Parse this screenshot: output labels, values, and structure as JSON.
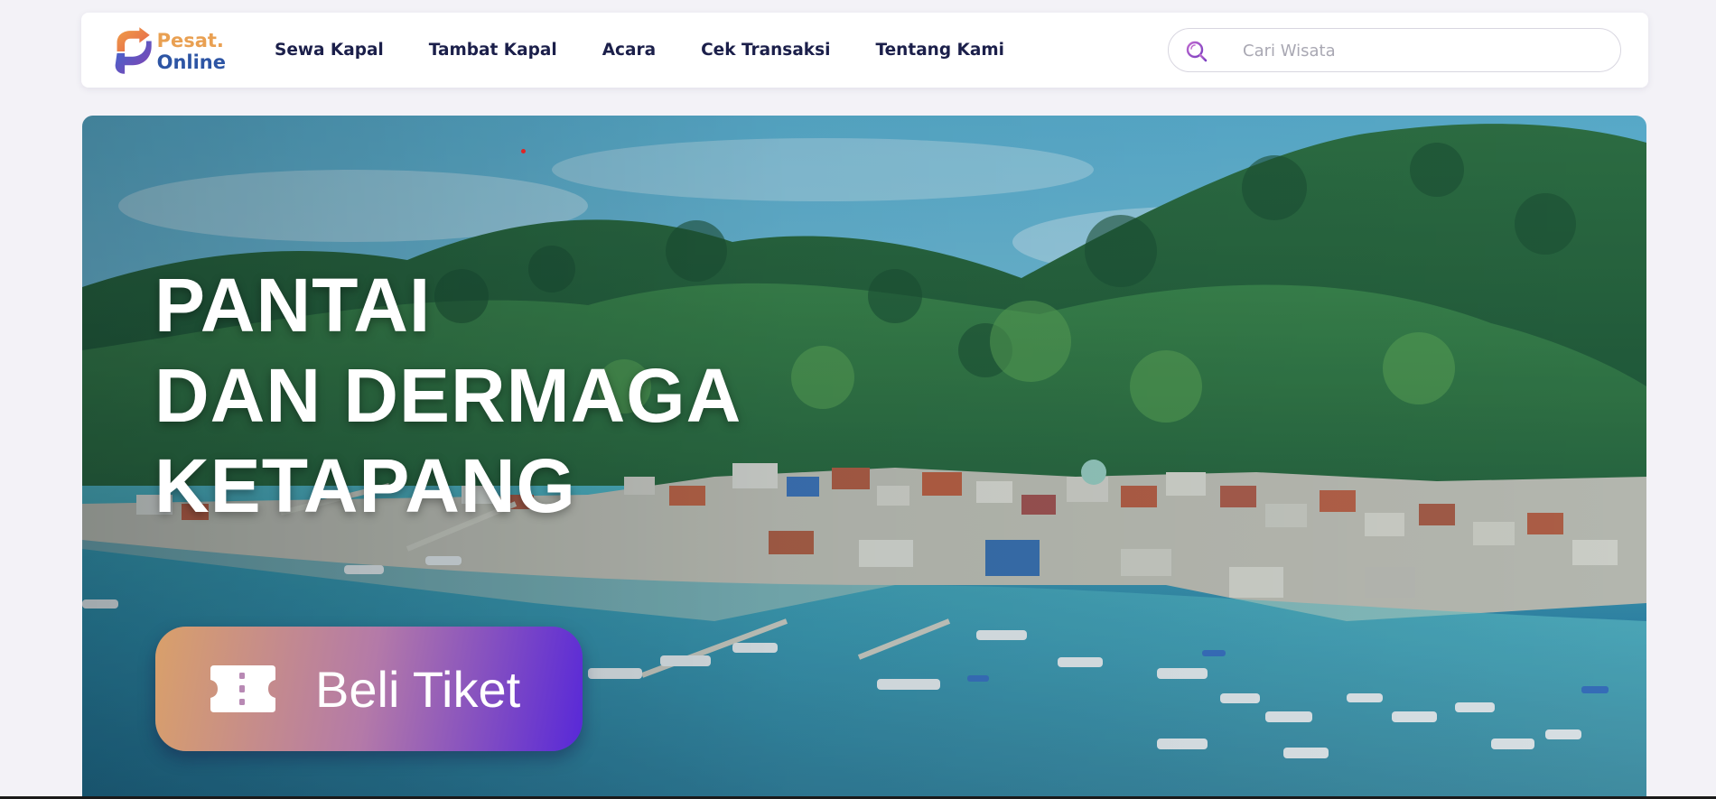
{
  "brand": {
    "line1": "Pesat.",
    "line2": "Online",
    "logo_colors": [
      "#e9a052",
      "#2d55a4",
      "#8a3fb0"
    ]
  },
  "nav": {
    "items": [
      {
        "label": "Sewa Kapal"
      },
      {
        "label": "Tambat Kapal"
      },
      {
        "label": "Acara"
      },
      {
        "label": "Cek Transaksi"
      },
      {
        "label": "Tentang Kami"
      }
    ]
  },
  "search": {
    "placeholder": "Cari Wisata",
    "value": "",
    "icon": "search-icon"
  },
  "hero": {
    "title_lines": [
      "PANTAI",
      "DAN DERMAGA",
      "KETAPANG"
    ],
    "cta_label": "Beli Tiket",
    "cta_icon": "ticket-icon",
    "image_subject": "aerial coastal village with green hills and boats"
  },
  "colors": {
    "nav_text": "#1b1f4a",
    "page_bg": "#f3f2f7",
    "cta_gradient": [
      "#d9a06a",
      "#b47aa8",
      "#5828d8"
    ]
  }
}
